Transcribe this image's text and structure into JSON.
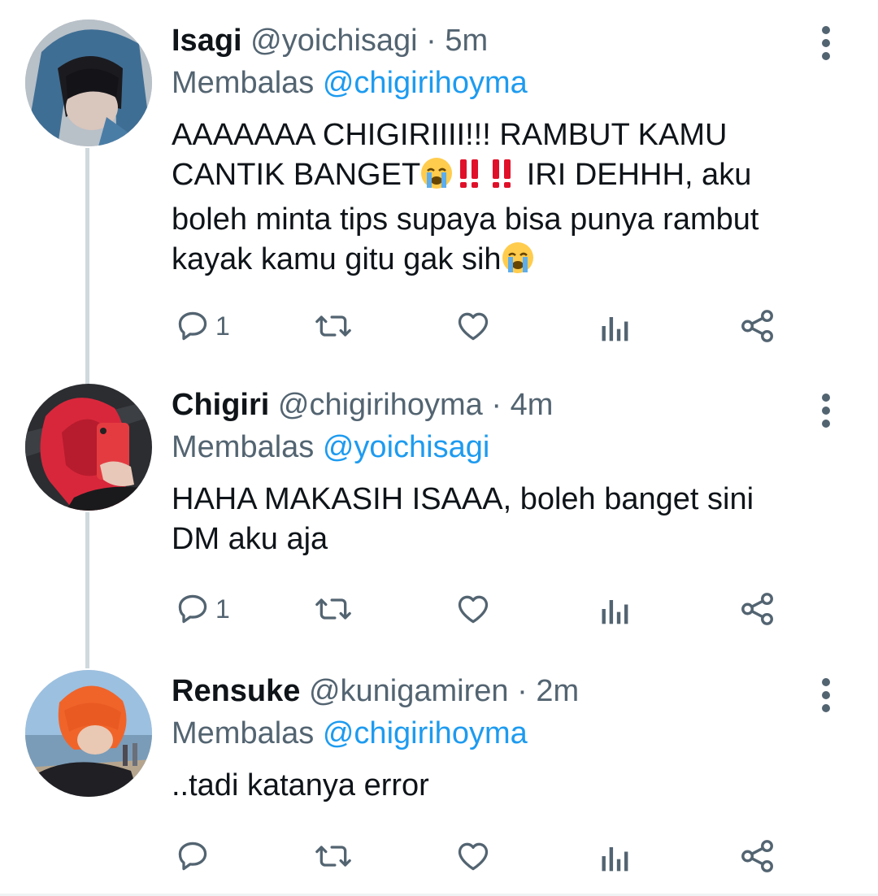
{
  "tweets": [
    {
      "name": "Isagi",
      "handle": "@yoichisagi",
      "separator": "·",
      "time": "5m",
      "reply_prefix": "Membalas",
      "reply_to": "@chigirihoyma",
      "text_line1": "AAAAAAA CHIGIRIIII!!! RAMBUT KAMU",
      "text_line2a": "CANTIK BANGET",
      "text_line2b": " IRI DEHHH, aku",
      "text_line3": "boleh minta tips supaya bisa punya rambut",
      "text_line4": "kayak kamu gitu gak sih",
      "reply_count": "1",
      "avatar_icon": "avatar-photo-blue-hood"
    },
    {
      "name": "Chigiri",
      "handle": "@chigirihoyma",
      "separator": "·",
      "time": "4m",
      "reply_prefix": "Membalas",
      "reply_to": "@yoichisagi",
      "text_line1": "HAHA MAKASIH ISAAA, boleh banget sini",
      "text_line2": "DM aku aja",
      "reply_count": "1",
      "avatar_icon": "avatar-photo-red-hair"
    },
    {
      "name": "Rensuke",
      "handle": "@kunigamiren",
      "separator": "·",
      "time": "2m",
      "reply_prefix": "Membalas",
      "reply_to": "@chigirihoyma",
      "text_line1": "..tadi katanya error",
      "reply_count": "",
      "avatar_icon": "avatar-photo-orange-hair"
    }
  ],
  "icons": [
    "reply-icon",
    "retweet-icon",
    "like-icon",
    "analytics-icon",
    "share-icon",
    "more-icon",
    "crying-emoji-icon",
    "double-exclamation-icon"
  ],
  "colors": {
    "accent": "#1d9bf0",
    "muted": "#536471",
    "thread": "#cfd9de",
    "exclaim": "#e0102a"
  }
}
